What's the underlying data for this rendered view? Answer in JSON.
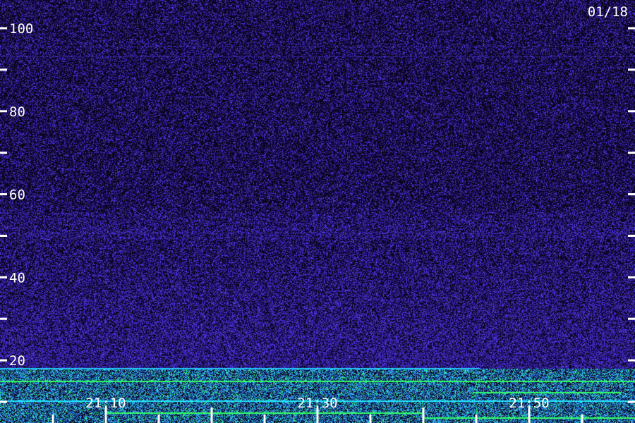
{
  "date_label": "01/18",
  "chart_data": {
    "type": "heatmap",
    "title": "",
    "xlabel": "",
    "ylabel": "",
    "x_range": [
      "21:00",
      "22:00"
    ],
    "x_ticks": [
      "21:10",
      "21:30",
      "21:50"
    ],
    "y_range": [
      0,
      105
    ],
    "y_ticks": [
      20,
      40,
      60,
      80,
      100
    ],
    "y_minor_step": 10,
    "x_minor_step_minutes": 5,
    "grid": false,
    "colormap": [
      "#000000",
      "#2a0a6e",
      "#4a1ee0",
      "#1a8cff",
      "#22e6ff",
      "#3cff6a"
    ],
    "colors": {
      "background": "#0e0420",
      "noise": "#3a20c8",
      "band_low": "#18b8ff",
      "band_highlight": "#33ff66",
      "axis_text": "#ffffff"
    }
  }
}
